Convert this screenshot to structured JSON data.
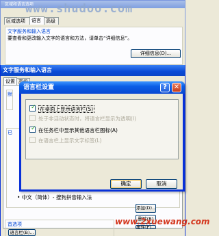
{
  "window_regional": {
    "title": "区域和语言选项",
    "watermark": "www.shudoo.com",
    "tabs": [
      "区域选项",
      "语言",
      "高级"
    ],
    "group_title": "文字服务和输入语言",
    "group_desc": "要查看和更改输入文字的语言和方法，请单击“详细信息”。",
    "details_button": "详细信息(D)..."
  },
  "window_text_services": {
    "title": "文字服务和输入语言",
    "tabs": [
      "设置",
      "高级"
    ],
    "side_label_1": "默",
    "side_label_2": "已",
    "list_item": "• 中文（简体）- 搜狗拼音输入法",
    "buttons": {
      "add": "添加(D)...",
      "remove": "删除(R)",
      "properties": "属性(P)..."
    },
    "prefs_title": "首选项",
    "language_bar_button": "语言栏(B)..."
  },
  "dialog": {
    "title": "语言栏设置",
    "options": [
      {
        "label": "在桌面上显示语言栏(S)",
        "checked": true,
        "enabled": true
      },
      {
        "label": "处于非活动状态时，将语言栏显示为透明(I)",
        "checked": false,
        "enabled": false
      },
      {
        "label": "在任务栏中显示其他语言栏图标(A)",
        "checked": true,
        "enabled": true
      },
      {
        "label": "在语言栏上显示文字标签(L)",
        "checked": false,
        "enabled": false
      }
    ],
    "ok_label": "确定",
    "cancel_label": "取消",
    "help_glyph": "?",
    "close_glyph": "✕"
  },
  "footer_watermark": "www.2xuewang.com",
  "colors": {
    "xp_blue": "#0a48d2",
    "close_red": "#c63d1a",
    "check_green": "#21a121",
    "watermark_red": "#d4381f"
  }
}
